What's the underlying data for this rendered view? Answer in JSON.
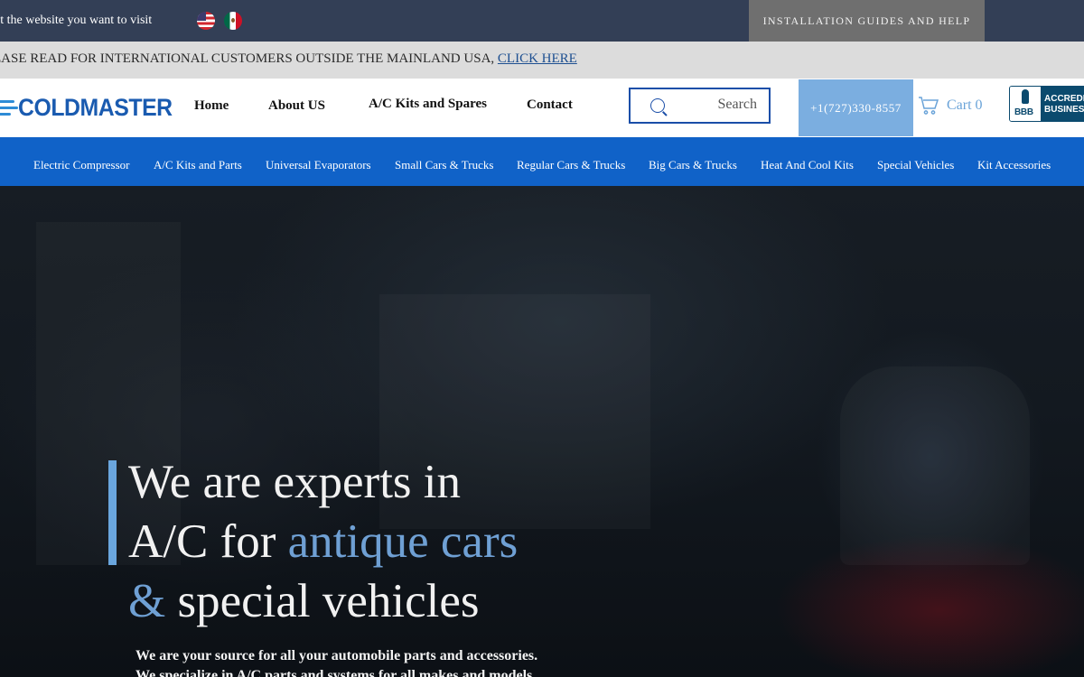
{
  "topbar": {
    "select_text": "ct the website you want to visit",
    "flags": [
      "us-flag-icon",
      "mexico-flag-icon"
    ],
    "install_label": "INSTALLATION GUIDES AND HELP"
  },
  "notice": {
    "text": "EASE READ FOR INTERNATIONAL CUSTOMERS OUTSIDE THE MAINLAND USA, ",
    "link_label": "CLICK HERE"
  },
  "header": {
    "logo_text": "COLDMASTER",
    "nav": [
      {
        "label": "Home"
      },
      {
        "label": "About US"
      },
      {
        "label": "A/C Kits and Spares"
      },
      {
        "label": "Contact"
      }
    ],
    "search": {
      "placeholder": "Search",
      "value": ""
    },
    "phone": "+1(727)330-8557",
    "cart": {
      "label": "Cart",
      "count": "0"
    },
    "bbb": {
      "logo_text": "BBB",
      "line1": "ACCREDI",
      "line2": "BUSINES"
    }
  },
  "categories": [
    {
      "label": "Electric Compressor"
    },
    {
      "label": "A/C Kits and Parts"
    },
    {
      "label": "Universal Evaporators"
    },
    {
      "label": "Small Cars & Trucks"
    },
    {
      "label": "Regular Cars & Trucks"
    },
    {
      "label": "Big Cars & Trucks"
    },
    {
      "label": "Heat And Cool Kits"
    },
    {
      "label": "Special Vehicles"
    },
    {
      "label": "Kit Accessories"
    }
  ],
  "hero": {
    "line1": "We are experts in",
    "line2_plain": "A/C for ",
    "line2_accent": "antique cars",
    "line3_accent": "&",
    "line3_plain": " special vehicles",
    "sub1": "We are your source for all your automobile parts and accessories.",
    "sub2": "We specialize in A/C parts and systems for all makes and models."
  },
  "colors": {
    "topbar": "#333f56",
    "brand_blue": "#1062c8",
    "accent_light_blue": "#6aa6de",
    "phone_bg": "#7baee0",
    "install_bg": "#6f6f6f"
  }
}
